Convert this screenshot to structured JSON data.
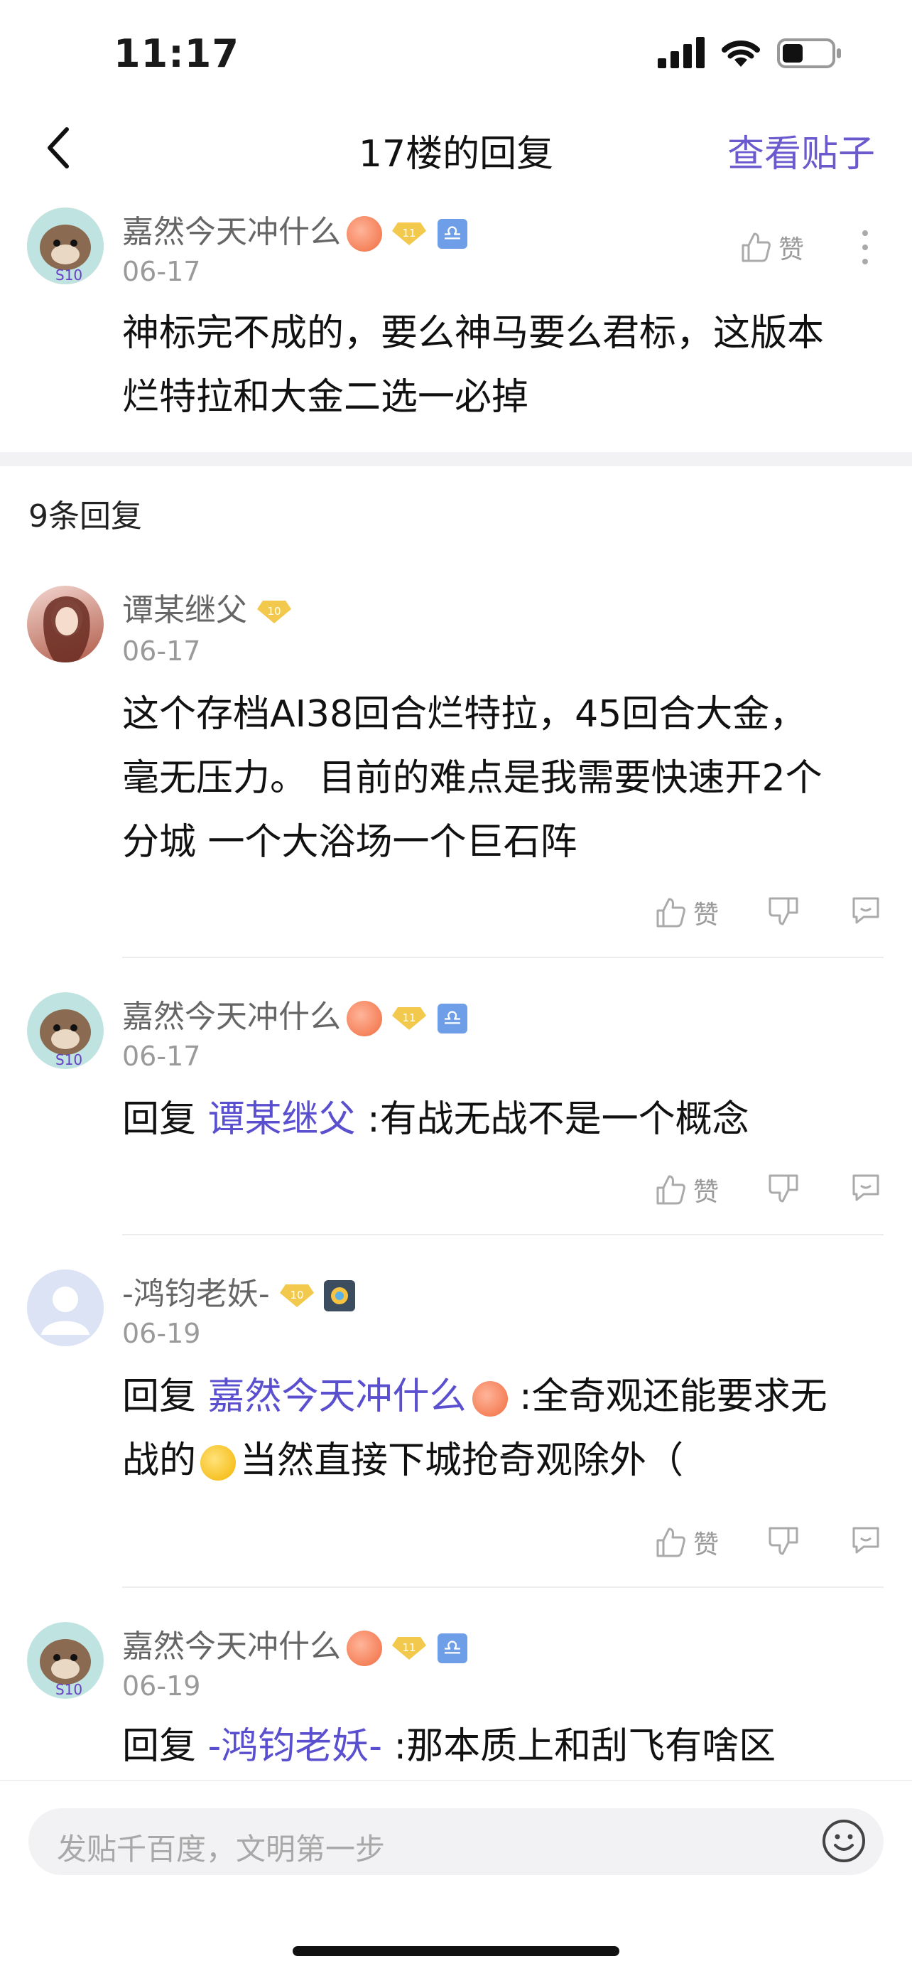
{
  "status": {
    "time": "11:17"
  },
  "nav": {
    "title": "17楼的回复",
    "view_post": "查看贴子"
  },
  "main_post": {
    "user": "嘉然今天冲什么",
    "level": "11",
    "date": "06-17",
    "like_label": "赞",
    "text_line1": "神标完不成的，要么神马要么君标，这版本",
    "text_line2": "烂特拉和大金二选一必掉"
  },
  "reply_count": "9条回复",
  "replies": [
    {
      "user": "谭某继父",
      "level": "10",
      "date": "06-17",
      "line1": "这个存档AI38回合烂特拉，45回合大金，",
      "line2": "毫无压力。 目前的难点是我需要快速开2个",
      "line3": "分城 一个大浴场一个巨石阵",
      "like_label": "赞"
    },
    {
      "user": "嘉然今天冲什么",
      "level": "11",
      "date": "06-17",
      "reply_prefix": "回复 ",
      "reply_to": "谭某继父",
      "text": " :有战无战不是一个概念",
      "like_label": "赞"
    },
    {
      "user": "-鸿钧老妖-",
      "level": "10",
      "date": "06-19",
      "reply_prefix": "回复 ",
      "reply_to": "嘉然今天冲什么",
      "text": " :全奇观还能要求无",
      "line2a": "战的",
      "line2b": "当然直接下城抢奇观除外（",
      "like_label": "赞"
    },
    {
      "user": "嘉然今天冲什么",
      "level": "11",
      "date": "06-19",
      "reply_prefix": "回复 ",
      "reply_to": "-鸿钧老妖-",
      "text": " :那本质上和刮飞有啥区"
    }
  ],
  "input": {
    "placeholder": "发贴千百度，文明第一步"
  },
  "colors": {
    "accent": "#6a5acd",
    "link": "#5a4fcf",
    "level_badge": "#f2c94c"
  }
}
